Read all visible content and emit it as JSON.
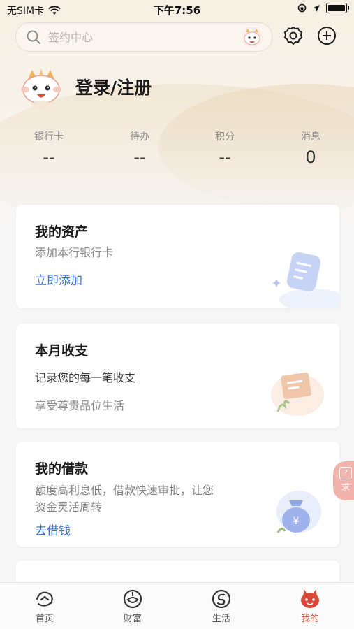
{
  "status_bar": {
    "carrier": "无SIM卡",
    "time": "下午7:56"
  },
  "search": {
    "placeholder": "签约中心"
  },
  "profile": {
    "login_label": "登录/注册"
  },
  "stats": [
    {
      "label": "银行卡",
      "value": "--"
    },
    {
      "label": "待办",
      "value": "--"
    },
    {
      "label": "积分",
      "value": "--"
    },
    {
      "label": "消息",
      "value": "0"
    }
  ],
  "cards": {
    "assets": {
      "title": "我的资产",
      "subtitle": "添加本行银行卡",
      "cta": "立即添加"
    },
    "monthly": {
      "title": "本月收支",
      "line1": "记录您的每一笔收支",
      "line2": "享受尊贵品位生活"
    },
    "loan": {
      "title": "我的借款",
      "line1": "额度高利息低，借款快速审批，让您",
      "line2": "资金灵活周转",
      "cta": "去借钱"
    }
  },
  "side_float": {
    "label": "求"
  },
  "tabbar": {
    "items": [
      {
        "label": "首页"
      },
      {
        "label": "财富"
      },
      {
        "label": "生活"
      },
      {
        "label": "我的"
      }
    ]
  },
  "colors": {
    "accent_blue": "#3a74d9",
    "active_tab": "#d8493a",
    "background": "#f6f6f7"
  }
}
